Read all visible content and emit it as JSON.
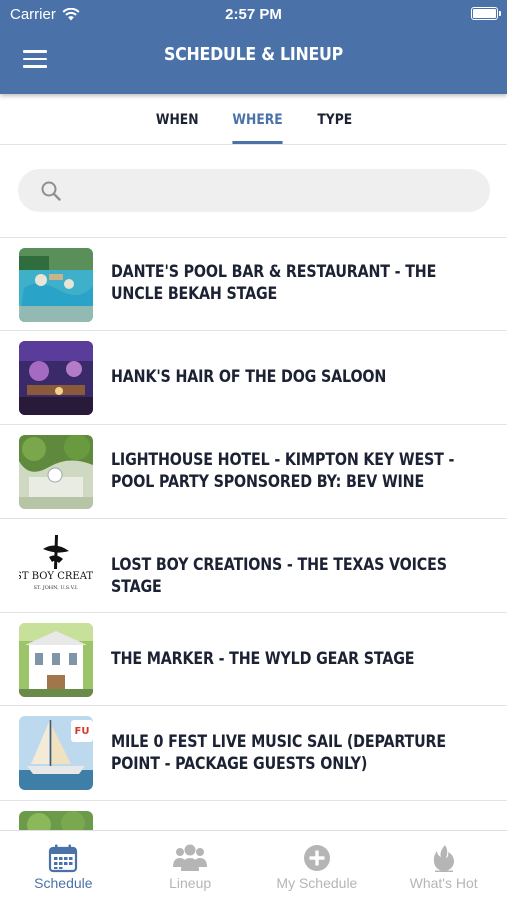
{
  "status_bar": {
    "carrier": "Carrier",
    "time": "2:57 PM"
  },
  "header": {
    "title": "SCHEDULE & LINEUP",
    "menu_icon": "hamburger-menu-icon"
  },
  "tabs": [
    {
      "label": "WHEN",
      "active": false
    },
    {
      "label": "WHERE",
      "active": true
    },
    {
      "label": "TYPE",
      "active": false
    }
  ],
  "search": {
    "placeholder": "",
    "value": "",
    "icon": "search-icon"
  },
  "venues": [
    {
      "name": "DANTE'S POOL BAR & RESTAURANT - THE UNCLE BEKAH STAGE",
      "thumb": "pool-photo"
    },
    {
      "name": "HANK'S HAIR OF THE DOG SALOON",
      "thumb": "saloon-photo"
    },
    {
      "name": "LIGHTHOUSE HOTEL - KIMPTON KEY WEST - POOL PARTY SPONSORED BY: BEV WINE",
      "thumb": "garden-photo"
    },
    {
      "name": "LOST BOY CREATIONS - THE TEXAS VOICES STAGE",
      "thumb": "logo-image",
      "thumb_text": "ST BOY CREATI",
      "thumb_subtext": "ST. JOHN, U.S.V.I."
    },
    {
      "name": "THE MARKER - THE WYLD GEAR STAGE",
      "thumb": "building-photo"
    },
    {
      "name": "MILE 0 FEST LIVE MUSIC SAIL (DEPARTURE POINT - PACKAGE GUESTS ONLY)",
      "thumb": "catamaran-photo"
    }
  ],
  "bottom_nav": [
    {
      "label": "Schedule",
      "icon": "calendar-icon",
      "active": true
    },
    {
      "label": "Lineup",
      "icon": "people-icon",
      "active": false
    },
    {
      "label": "My Schedule",
      "icon": "plus-circle-icon",
      "active": false
    },
    {
      "label": "What's Hot",
      "icon": "flame-icon",
      "active": false
    }
  ],
  "colors": {
    "accent": "#4a72a8",
    "text": "#1c2233",
    "inactive": "#b5b5b5",
    "divider": "#e3e3e3"
  }
}
